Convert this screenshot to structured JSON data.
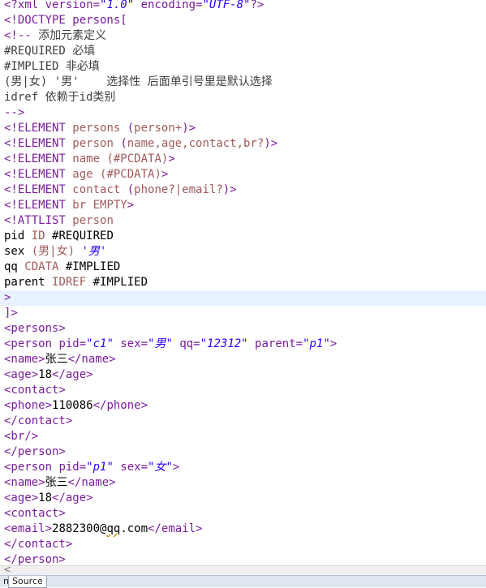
{
  "editor": {
    "lines": [
      {
        "segments": [
          {
            "c": "tag",
            "t": "<?xml "
          },
          {
            "c": "att",
            "t": "version="
          },
          {
            "c": "str",
            "t": "\"1.0\""
          },
          {
            "c": "att",
            "t": " encoding="
          },
          {
            "c": "str",
            "t": "\"UTF-8\""
          },
          {
            "c": "tag",
            "t": "?>"
          }
        ]
      },
      {
        "segments": [
          {
            "c": "tag",
            "t": "<!DOCTYPE persons["
          }
        ]
      },
      {
        "segments": [
          {
            "c": "tag",
            "t": "<!-- "
          },
          {
            "c": "kw",
            "t": "添加元素定义"
          }
        ]
      },
      {
        "segments": [
          {
            "c": "kw",
            "t": "#REQUIRED 必填"
          }
        ]
      },
      {
        "segments": [
          {
            "c": "kw",
            "t": "#IMPLIED 非必填"
          }
        ]
      },
      {
        "segments": [
          {
            "c": "kw",
            "t": "(男|女) '男'    选择性 后面单引号里是默认选择"
          }
        ]
      },
      {
        "segments": [
          {
            "c": "kw",
            "t": "idref 依赖于id类别"
          }
        ]
      },
      {
        "segments": [
          {
            "c": "tag",
            "t": "-->"
          }
        ]
      },
      {
        "segments": [
          {
            "c": "tag",
            "t": "<!ELEMENT "
          },
          {
            "c": "dt",
            "t": "persons "
          },
          {
            "c": "tag",
            "t": "("
          },
          {
            "c": "dt",
            "t": "person+"
          },
          {
            "c": "tag",
            "t": ")>"
          }
        ]
      },
      {
        "segments": [
          {
            "c": "tag",
            "t": "<!ELEMENT "
          },
          {
            "c": "dt",
            "t": "person "
          },
          {
            "c": "tag",
            "t": "("
          },
          {
            "c": "dt",
            "t": "name,age,contact,br?"
          },
          {
            "c": "tag",
            "t": ")>"
          }
        ]
      },
      {
        "segments": [
          {
            "c": "tag",
            "t": "<!ELEMENT "
          },
          {
            "c": "dt",
            "t": "name (#PCDATA)"
          },
          {
            "c": "tag",
            "t": ">"
          }
        ]
      },
      {
        "segments": [
          {
            "c": "tag",
            "t": "<!ELEMENT "
          },
          {
            "c": "dt",
            "t": "age (#PCDATA)"
          },
          {
            "c": "tag",
            "t": ">"
          }
        ]
      },
      {
        "segments": [
          {
            "c": "tag",
            "t": "<!ELEMENT "
          },
          {
            "c": "dt",
            "t": "contact "
          },
          {
            "c": "tag",
            "t": "("
          },
          {
            "c": "dt",
            "t": "phone?|email?"
          },
          {
            "c": "tag",
            "t": ")>"
          }
        ]
      },
      {
        "segments": [
          {
            "c": "tag",
            "t": "<!ELEMENT "
          },
          {
            "c": "dt",
            "t": "br EMPTY"
          },
          {
            "c": "tag",
            "t": ">"
          }
        ]
      },
      {
        "segments": [
          {
            "c": "tag",
            "t": "<!ATTLIST "
          },
          {
            "c": "dt",
            "t": "person"
          }
        ]
      },
      {
        "segments": [
          {
            "c": "txt",
            "t": "pid "
          },
          {
            "c": "dt",
            "t": "ID "
          },
          {
            "c": "txt",
            "t": "#REQUIRED"
          }
        ]
      },
      {
        "segments": [
          {
            "c": "txt",
            "t": "sex "
          },
          {
            "c": "dt",
            "t": "(男|女) "
          },
          {
            "c": "str",
            "t": "'男'"
          }
        ]
      },
      {
        "segments": [
          {
            "c": "txt",
            "t": "qq "
          },
          {
            "c": "dt",
            "t": "CDATA "
          },
          {
            "c": "txt",
            "t": "#IMPLIED"
          }
        ]
      },
      {
        "segments": [
          {
            "c": "txt",
            "t": "parent "
          },
          {
            "c": "dt",
            "t": "IDREF "
          },
          {
            "c": "txt",
            "t": "#IMPLIED"
          }
        ]
      },
      {
        "segments": [
          {
            "c": "tag",
            "t": ">"
          }
        ],
        "highlight": true
      },
      {
        "segments": [
          {
            "c": "tag",
            "t": "]>"
          }
        ]
      },
      {
        "segments": [
          {
            "c": "tag",
            "t": "<persons>"
          }
        ]
      },
      {
        "segments": [
          {
            "c": "tag",
            "t": "<person "
          },
          {
            "c": "att",
            "t": "pid="
          },
          {
            "c": "str",
            "t": "\"c1\""
          },
          {
            "c": "att",
            "t": " sex="
          },
          {
            "c": "str",
            "t": "\"男\""
          },
          {
            "c": "att",
            "t": " qq="
          },
          {
            "c": "str",
            "t": "\"12312\""
          },
          {
            "c": "att",
            "t": " parent="
          },
          {
            "c": "str",
            "t": "\"p1\""
          },
          {
            "c": "tag",
            "t": ">"
          }
        ]
      },
      {
        "segments": [
          {
            "c": "tag",
            "t": "<name>"
          },
          {
            "c": "txt",
            "t": "张三"
          },
          {
            "c": "tag",
            "t": "</name>"
          }
        ]
      },
      {
        "segments": [
          {
            "c": "tag",
            "t": "<age>"
          },
          {
            "c": "txt",
            "t": "18"
          },
          {
            "c": "tag",
            "t": "</age>"
          }
        ]
      },
      {
        "segments": [
          {
            "c": "tag",
            "t": "<contact>"
          }
        ]
      },
      {
        "segments": [
          {
            "c": "tag",
            "t": "<phone>"
          },
          {
            "c": "txt",
            "t": "110086"
          },
          {
            "c": "tag",
            "t": "</phone>"
          }
        ]
      },
      {
        "segments": [
          {
            "c": "tag",
            "t": "</contact>"
          }
        ]
      },
      {
        "segments": [
          {
            "c": "tag",
            "t": "<br/>"
          }
        ]
      },
      {
        "segments": [
          {
            "c": "tag",
            "t": "</person>"
          }
        ]
      },
      {
        "segments": [
          {
            "c": "tag",
            "t": "<person "
          },
          {
            "c": "att",
            "t": "pid="
          },
          {
            "c": "str",
            "t": "\"p1\""
          },
          {
            "c": "att",
            "t": " sex="
          },
          {
            "c": "str",
            "t": "\"女\""
          },
          {
            "c": "tag",
            "t": ">"
          }
        ]
      },
      {
        "segments": [
          {
            "c": "tag",
            "t": "<name>"
          },
          {
            "c": "txt",
            "t": "张三"
          },
          {
            "c": "tag",
            "t": "</name>"
          }
        ]
      },
      {
        "segments": [
          {
            "c": "tag",
            "t": "<age>"
          },
          {
            "c": "txt",
            "t": "18"
          },
          {
            "c": "tag",
            "t": "</age>"
          }
        ]
      },
      {
        "segments": [
          {
            "c": "tag",
            "t": "<contact>"
          }
        ]
      },
      {
        "segments": [
          {
            "c": "tag",
            "t": "<email>"
          },
          {
            "c": "txt",
            "t": "2882300@"
          },
          {
            "c": "sq",
            "t": "qq"
          },
          {
            "c": "txt",
            "t": ".com"
          },
          {
            "c": "tag",
            "t": "</email>"
          }
        ]
      },
      {
        "segments": [
          {
            "c": "tag",
            "t": "</contact>"
          }
        ]
      },
      {
        "segments": [
          {
            "c": "tag",
            "t": "</person>"
          }
        ]
      }
    ]
  },
  "scrollbar": {
    "left_arrow": "<"
  },
  "tabs": [
    {
      "label": "n",
      "active": false
    },
    {
      "label": "Source",
      "active": true
    }
  ]
}
